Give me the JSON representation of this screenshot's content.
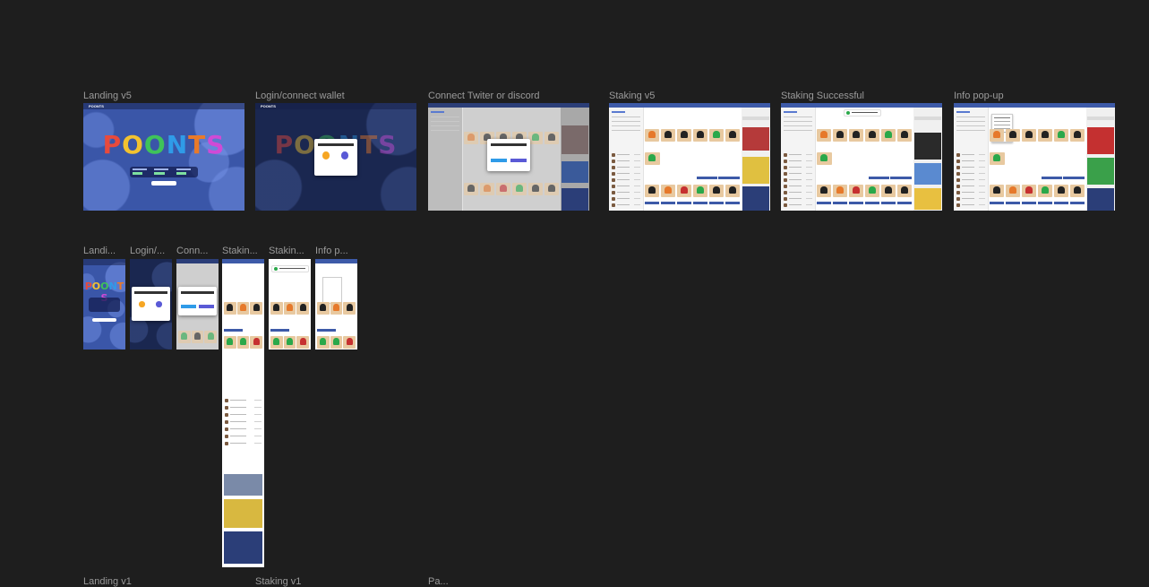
{
  "canvas": {
    "background": "#1e1e1e"
  },
  "frames_row1": [
    {
      "label": "Landing v5",
      "type": "landing"
    },
    {
      "label": "Login/connect wallet",
      "type": "login"
    },
    {
      "label": "Connect Twiter or discord",
      "type": "connect"
    },
    {
      "label": "Staking v5",
      "type": "staking"
    },
    {
      "label": "Staking Successful",
      "type": "success"
    },
    {
      "label": "Info pop-up",
      "type": "info"
    }
  ],
  "frames_row2": [
    {
      "label": "Landi...",
      "type": "m-landing"
    },
    {
      "label": "Login/...",
      "type": "m-login"
    },
    {
      "label": "Conn...",
      "type": "m-connect"
    },
    {
      "label": "Stakin...",
      "type": "m-staking"
    },
    {
      "label": "Stakin...",
      "type": "m-success"
    },
    {
      "label": "Info p...",
      "type": "m-info"
    }
  ],
  "frames_row3": [
    {
      "label": "Landing v1"
    },
    {
      "label": "Staking v1"
    },
    {
      "label": "Pa..."
    }
  ],
  "content": {
    "brand": "POONTS",
    "logo_text": "POONTS",
    "logo_colors": [
      "#e84a3c",
      "#f2c230",
      "#3fc35a",
      "#2f9be8",
      "#e87a2a",
      "#d04ad6"
    ],
    "accent": "#3d5aa8"
  }
}
